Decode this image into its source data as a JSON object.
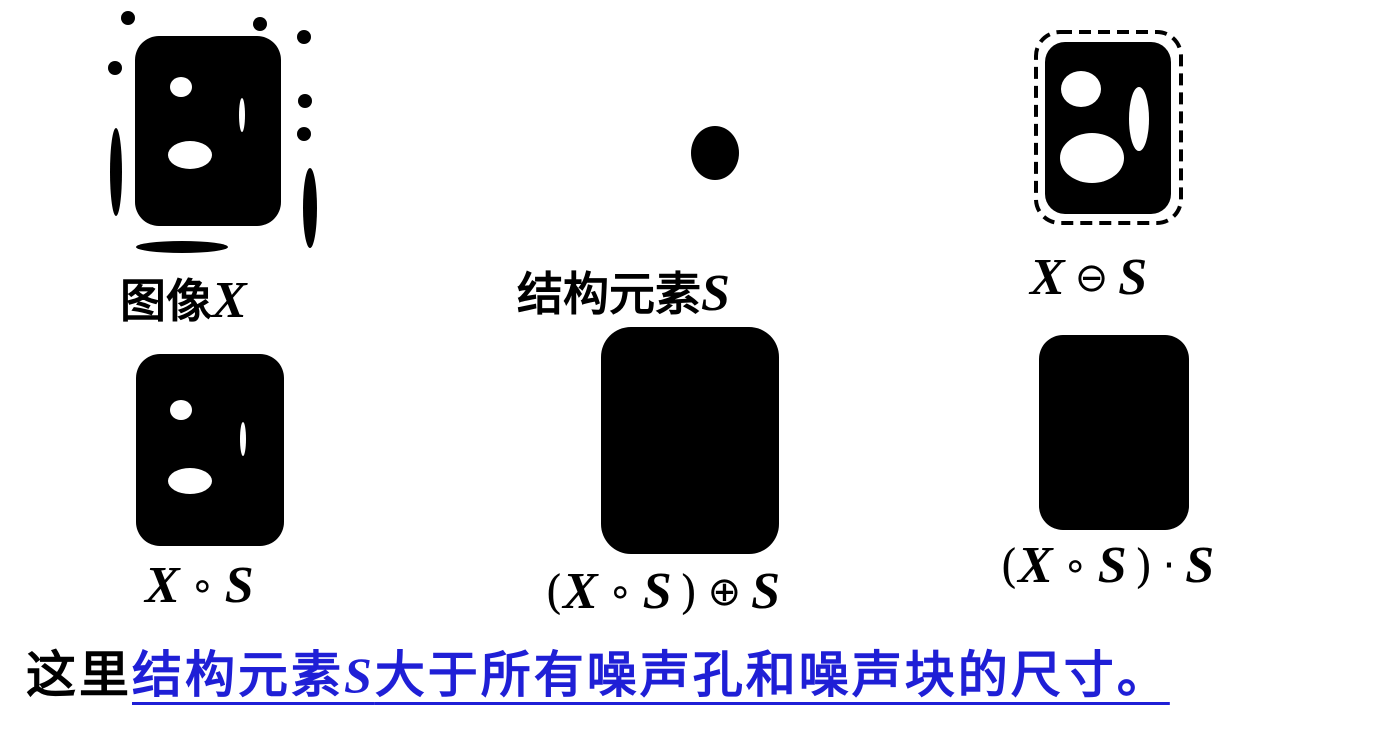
{
  "labels": {
    "image": {
      "prefix": "图像",
      "var": "X"
    },
    "struct": {
      "prefix": "结构元素",
      "var": "S"
    },
    "erosion": {
      "left": "X",
      "op": "⊖",
      "right": "S"
    },
    "opening": {
      "left": "X",
      "op": "∘",
      "right": "S"
    },
    "dilation": {
      "open_paren": "(",
      "left": "X",
      "op_inner": "∘",
      "right": "S",
      "close_paren": ")",
      "op": "⊕",
      "rhs": "S"
    },
    "closing": {
      "open_paren": "(",
      "left": "X",
      "op_inner": "∘",
      "right": "S",
      "close_paren": ")",
      "op": "·",
      "rhs": "S"
    }
  },
  "caption": {
    "plain": "这里",
    "emph_1": "结构元素",
    "emph_var": "S",
    "emph_2": "大于所有噪声孔和噪声块的尺寸。"
  },
  "colors": {
    "shape": "#000000",
    "background": "#ffffff",
    "caption_emphasis": "#1f1fd6"
  }
}
